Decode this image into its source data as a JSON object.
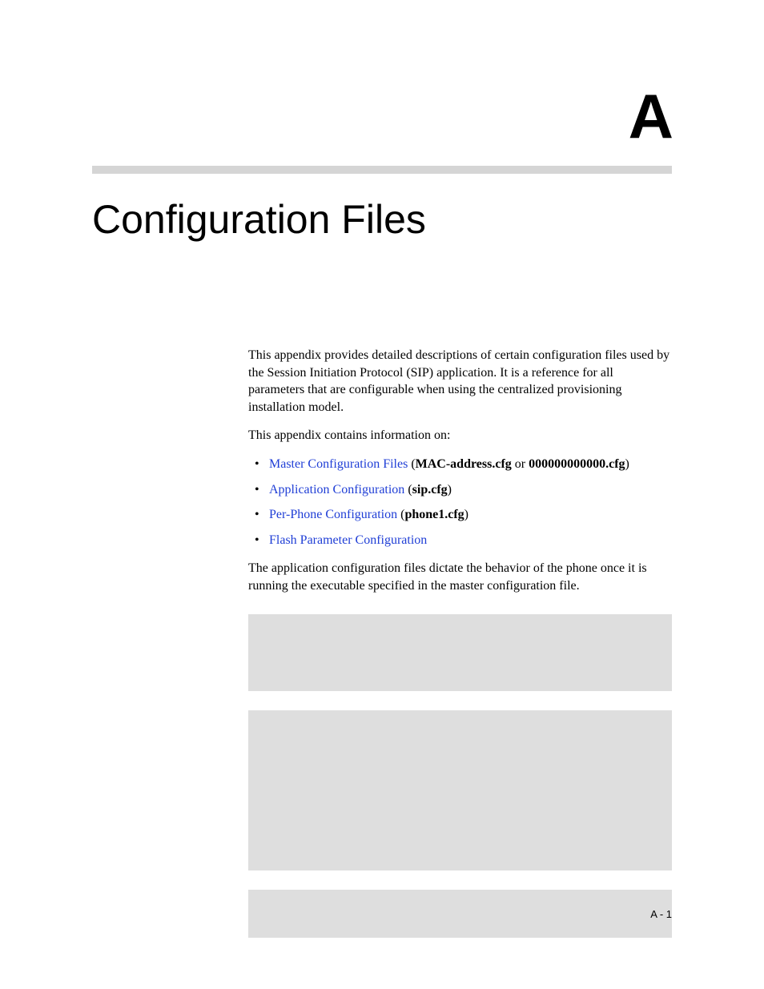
{
  "header": {
    "appendix_letter": "A",
    "title": "Configuration Files"
  },
  "content": {
    "intro_paragraph": "This appendix provides detailed descriptions of certain configuration files used by the Session Initiation Protocol (SIP) application. It is a reference for all parameters that are configurable when using the centralized provisioning installation model.",
    "lead_in": "This appendix contains information on:",
    "list_items": [
      {
        "link_text": "Master Configuration Files",
        "suffix_open": " (",
        "bold1": "MAC-address.cfg",
        "mid": " or ",
        "bold2": "000000000000.cfg",
        "suffix_close": ")"
      },
      {
        "link_text": "Application Configuration",
        "suffix_open": " (",
        "bold1": "sip.cfg",
        "mid": "",
        "bold2": "",
        "suffix_close": ")"
      },
      {
        "link_text": "Per-Phone Configuration",
        "suffix_open": " (",
        "bold1": "phone1.cfg",
        "mid": "",
        "bold2": "",
        "suffix_close": ")"
      },
      {
        "link_text": "Flash Parameter Configuration",
        "suffix_open": "",
        "bold1": "",
        "mid": "",
        "bold2": "",
        "suffix_close": ""
      }
    ],
    "closing_paragraph": "The application configuration files dictate the behavior of the phone once it is running the executable specified in the master configuration file."
  },
  "footer": {
    "page_number": "A - 1"
  }
}
